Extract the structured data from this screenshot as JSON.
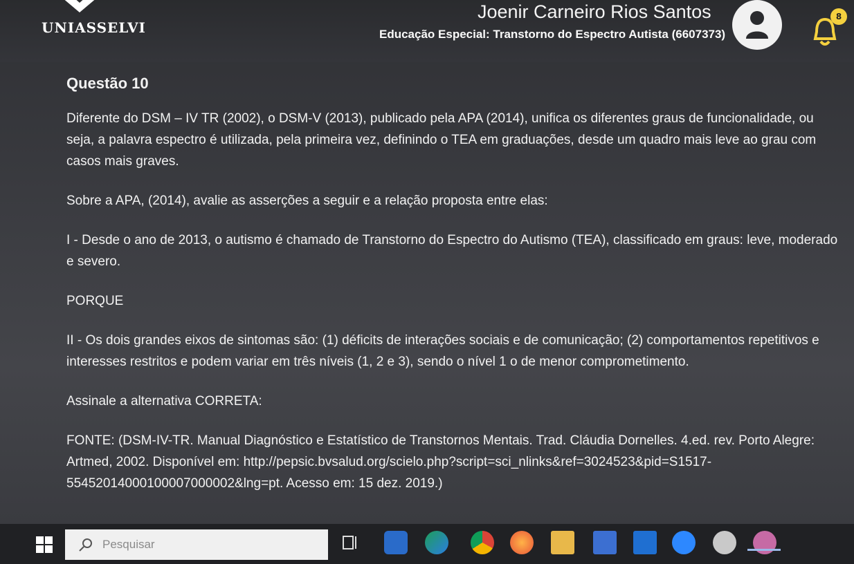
{
  "header": {
    "logo_text": "UNIASSELVI",
    "user_name": "Joenir Carneiro Rios Santos",
    "course": "Educação Especial: Transtorno do Espectro Autista (6607373)",
    "notification_count": "8"
  },
  "question": {
    "title": "Questão 10",
    "intro": "Diferente do DSM – IV TR (2002), o DSM-V (2013), publicado pela APA (2014), unifica os diferentes graus de funcionalidade, ou seja, a palavra espectro é utilizada, pela primeira vez, definindo o TEA em graduações, desde um quadro mais leve ao grau com casos mais graves.",
    "prompt": "Sobre a APA, (2014), avalie as asserções a seguir e a relação proposta entre elas:",
    "assertion_1": "I - Desde o ano de 2013, o autismo é chamado de Transtorno do Espectro do Autismo (TEA), classificado em graus: leve, moderado e severo.",
    "connector": "PORQUE",
    "assertion_2": "II - Os dois grandes eixos de sintomas são: (1) déficits de interações sociais e de comunicação; (2) comportamentos repetitivos e interesses restritos e podem variar em três níveis (1, 2 e 3), sendo o nível 1 o de menor comprometimento.",
    "instruction": "Assinale a alternativa CORRETA:",
    "source": "FONTE: (DSM-IV-TR. Manual Diagnóstico e Estatístico de Transtornos Mentais. Trad. Cláudia Dornelles. 4.ed. rev. Porto Alegre: Artmed, 2002. Disponível em: http://pepsic.bvsalud.org/scielo.php?script=sci_nlinks&ref=3024523&pid=S1517-55452014000100007000002&lng=pt. Acesso em: 15 dez. 2019.)"
  },
  "taskbar": {
    "search_placeholder": "Pesquisar",
    "icons": [
      "windows-icon",
      "search-icon",
      "task-view-icon",
      "app-icon",
      "edge-icon",
      "chrome-icon",
      "firefox-icon",
      "folder-icon",
      "store-icon",
      "outlook-icon",
      "facebook-icon",
      "app-circle-icon",
      "people-icon"
    ]
  },
  "colors": {
    "background": "#3b3c41",
    "text": "#f2f2f2",
    "taskbar": "#202124",
    "badge": "#f4d03f"
  }
}
